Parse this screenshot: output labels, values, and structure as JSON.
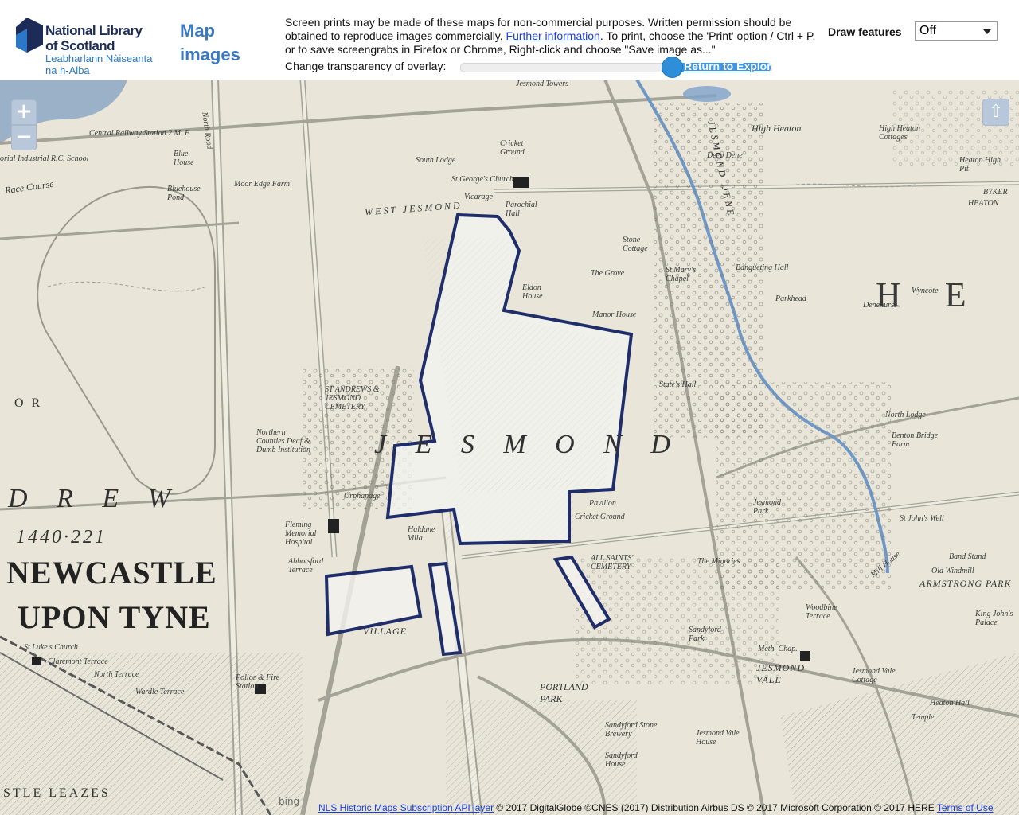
{
  "header": {
    "logo": {
      "line1": "National Library of Scotland",
      "line2": "Leabharlann Nàiseanta na h-Alba"
    },
    "map_images_link": "Map images",
    "notice_part1": "Screen prints may be made of these maps for non-commercial purposes. Written permission should be obtained to reproduce images commercially. ",
    "notice_link": "Further information",
    "notice_part2": ". To print, choose the 'Print' option / Ctrl + P, or to save screengrabs in Firefox or Chrome, Right-click and choose \"Save image as...\"",
    "transparency_label": "Change transparency of overlay:",
    "transparency_value": 0.68,
    "return_link": "Return to Explore",
    "draw_features_label": "Draw features",
    "draw_features_value": "Off"
  },
  "map": {
    "labels": {
      "west_jesmond": "WEST JESMOND",
      "jesmond": "J E S M O N D",
      "he": "H E",
      "or": "O R",
      "drew": "D R E W",
      "num": "1440·221",
      "newcastle": "NEWCASTLE",
      "upon_tyne": "UPON TYNE",
      "leazes": "STLE LEAZES",
      "armstrong_park": "ARMSTRONG PARK",
      "high_heaton": "High Heaton",
      "high_heaton_cottages": "High Heaton Cottages",
      "heaton_high_pit": "Heaton High Pit",
      "byker": "BYKER",
      "heaton": "HEATON",
      "cricket_ground": "Cricket Ground",
      "south_lodge": "South Lodge",
      "st_george_church": "St George's Church",
      "vicarage": "Vicarage",
      "parochial_hall": "Parochial Hall",
      "moor_edge_farm": "Moor Edge Farm",
      "race_course": "Race Course",
      "blue_house": "Blue House",
      "bluehouse_pond": "Bluehouse Pond",
      "central_railway_station": "Central Railway Station 2 M. F.",
      "industrial_school": "orial Industrial R.C. School",
      "jesmond_towers": "Jesmond Towers",
      "jesmond_dene": "JESMOND DENE",
      "deep_dene": "Deep Dene",
      "stone_cottage": "Stone Cottage",
      "the_grove": "The Grove",
      "banqueting_hall": "Banqueting Hall",
      "parkhead": "Parkhead",
      "denehurst": "Denehurst",
      "wyncote": "Wyncote",
      "north_lodge": "North Lodge",
      "benton_bridge_farm": "Benton Bridge Farm",
      "jesmond_park": "Jesmond Park",
      "pavilion": "Pavilion",
      "cricket_ground_2": "Cricket Ground",
      "all_saints_cemetery": "ALL SAINTS' CEMETERY",
      "the_minories": "The Minories",
      "sandyford_park": "Sandyford Park",
      "jesmond_vale": "JESMOND VALE",
      "jesmond_vale_cottage": "Jesmond Vale Cottage",
      "sandyford_stone_brewery": "Sandyford Stone Brewery",
      "sandyford_house": "Sandyford House",
      "jesmond_vale_house": "Jesmond Vale House",
      "heaton_hall": "Heaton Hall",
      "temple": "Temple",
      "orphanage": "Orphanage",
      "fleming_hospital": "Fleming Memorial Hospital",
      "abbotsford_terrace": "Abbotsford Terrace",
      "police_fire_station": "Police & Fire Station",
      "northern_counties_institution": "Northern Counties Deaf & Dumb Institution",
      "st_andrews_cemetery": "ST ANDREWS & JESMOND CEMETERY",
      "portland_park": "PORTLAND PARK",
      "saint_marys_chapel": "St Mary's Chapel",
      "manor_house": "Manor House",
      "eldon_house": "Eldon House",
      "north_road": "North Road",
      "haldane_villa": "Haldane Villa",
      "stella_hall": "State's Hall",
      "village": "VILLAGE",
      "old_windmill": "Old Windmill",
      "band_stand": "Band Stand",
      "king_johns_palace": "King John's Palace",
      "saint_johns_well": "St John's Well",
      "mill_house": "Mill House",
      "woodbine_terrace": "Woodbine Terrace",
      "meth_chap": "Meth. Chap.",
      "lakes_church": "St Luke's Church",
      "claremont_terrace": "Claremont Terrace",
      "wardle_terrace": "Wardle Terrace",
      "north_terrace": "North Terrace"
    }
  },
  "controls": {
    "zoom_in": "+",
    "zoom_out": "−",
    "up_arrow": "⇧"
  },
  "attribution": {
    "link1": "NLS Historic Maps Subscription API layer",
    "text": " © 2017 DigitalGlobe ©CNES (2017) Distribution Airbus DS © 2017 Microsoft Corporation © 2017 HERE ",
    "link2": "Terms of Use",
    "bing": "bing"
  },
  "colors": {
    "overlay_outline": "#1f2d6a",
    "map_paper": "#e9e6d9",
    "water": "#6f98c7",
    "header_link": "#3b78c2"
  }
}
